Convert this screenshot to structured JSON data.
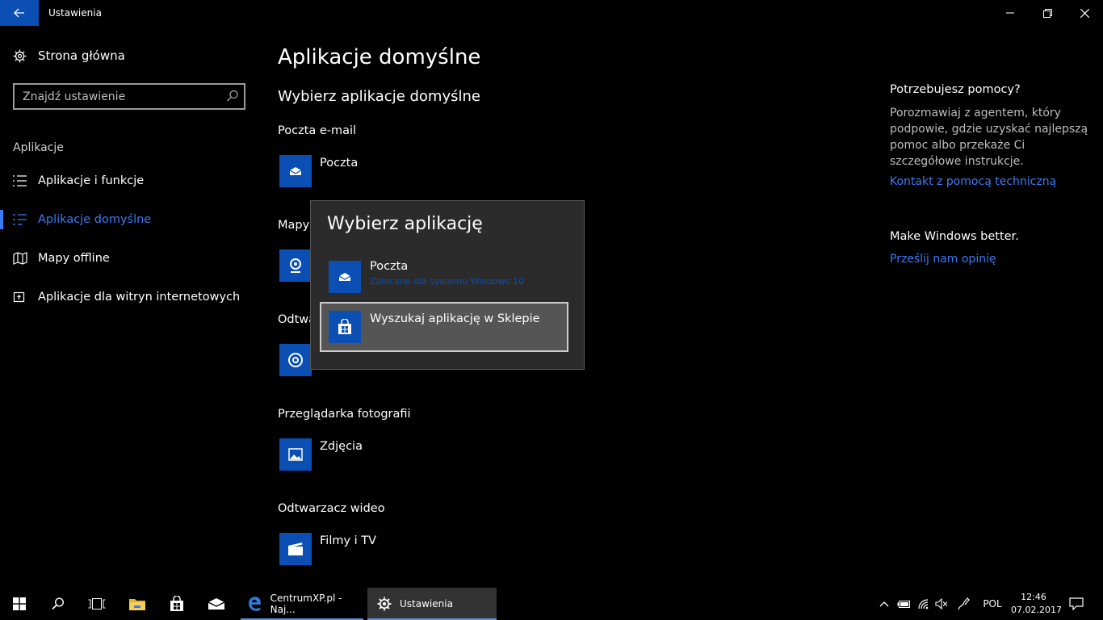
{
  "window": {
    "title": "Ustawienia"
  },
  "sidebar": {
    "home_label": "Strona główna",
    "search_placeholder": "Znajdź ustawienie",
    "section": "Aplikacje",
    "items": [
      {
        "label": "Aplikacje i funkcje",
        "icon": "list-icon",
        "active": false
      },
      {
        "label": "Aplikacje domyślne",
        "icon": "default-apps-icon",
        "active": true
      },
      {
        "label": "Mapy offline",
        "icon": "map-icon",
        "active": false
      },
      {
        "label": "Aplikacje dla witryn internetowych",
        "icon": "website-apps-icon",
        "active": false
      }
    ]
  },
  "main": {
    "page_title": "Aplikacje domyślne",
    "section_title": "Wybierz aplikacje domyślne",
    "categories": [
      {
        "label": "Poczta e-mail",
        "app": "Poczta",
        "icon": "mail-icon"
      },
      {
        "label": "Mapy",
        "app": "",
        "icon": "maps-icon"
      },
      {
        "label": "Odtwa",
        "app": "",
        "icon": "music-icon"
      },
      {
        "label": "Przeglądarka fotografii",
        "app": "Zdjęcia",
        "icon": "photos-icon"
      },
      {
        "label": "Odtwarzacz wideo",
        "app": "Filmy i TV",
        "icon": "video-icon"
      }
    ]
  },
  "popup": {
    "title": "Wybierz aplikację",
    "items": [
      {
        "name": "Poczta",
        "sub": "Zalecane dla systemu Windows 10",
        "icon": "mail-icon"
      },
      {
        "name": "Wyszukaj aplikację w Sklepie",
        "sub": "",
        "icon": "store-icon"
      }
    ]
  },
  "help": {
    "title": "Potrzebujesz pomocy?",
    "text": "Porozmawiaj z agentem, który podpowie, gdzie uzyskać najlepszą pomoc albo przekaże Ci szczegółowe instrukcje.",
    "link": "Kontakt z pomocą techniczną",
    "title2": "Make Windows better.",
    "link2": "Prześlij nam opinię"
  },
  "taskbar": {
    "apps": [
      {
        "label": "CentrumXP.pl - Naj...",
        "icon": "edge-icon"
      },
      {
        "label": "Ustawienia",
        "icon": "gear-icon"
      }
    ],
    "language": "POL",
    "time": "12:46",
    "date": "07.02.2017"
  },
  "colors": {
    "accent": "#0b4fb5",
    "link": "#3a7bf5",
    "popup_bg": "#2b2b2b"
  }
}
